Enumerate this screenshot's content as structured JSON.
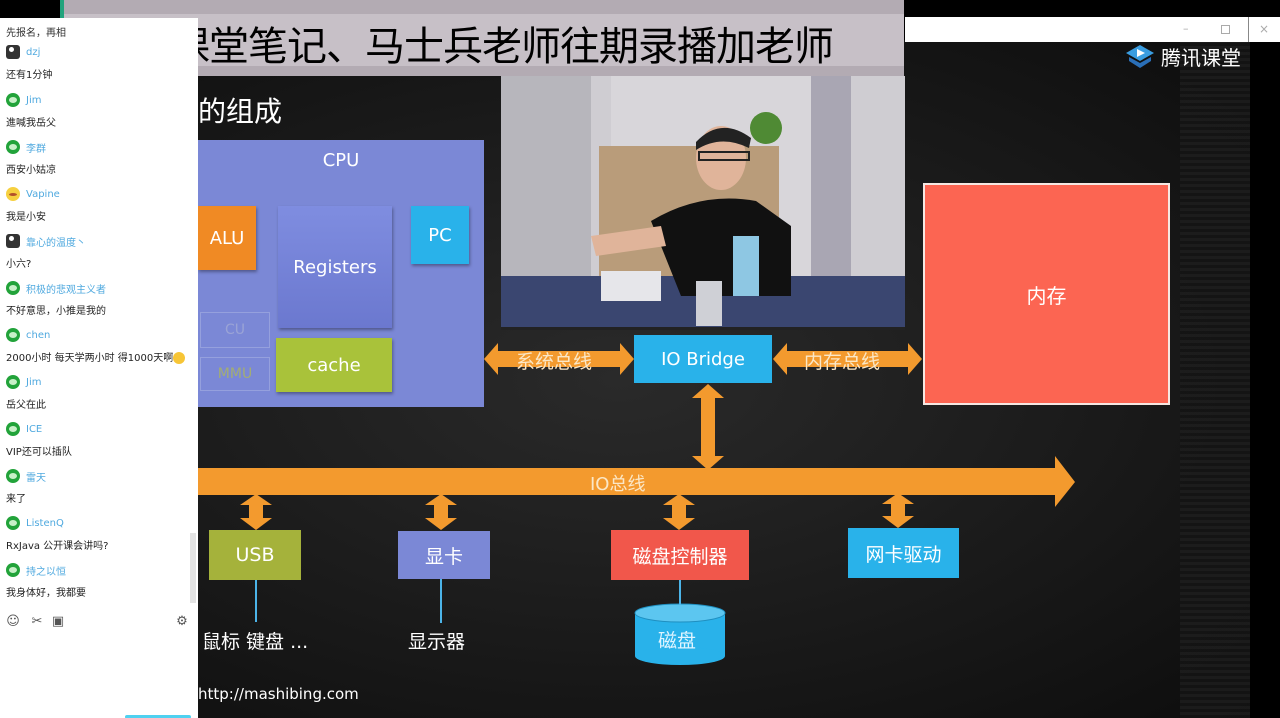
{
  "window": {
    "controls": {
      "minimize": "–",
      "close": "×"
    }
  },
  "banner": {
    "text": "领取课堂笔记、马士兵老师往期录播加老师"
  },
  "branding": {
    "logo_icon": "tencent-classroom-play-icon",
    "name": "腾讯课堂"
  },
  "slide": {
    "title": "的组成",
    "cpu": {
      "label": "CPU",
      "alu": "ALU",
      "registers": "Registers",
      "pc": "PC",
      "cu": "CU",
      "mmu": "MMU",
      "cache": "cache"
    },
    "io_bridge": "IO Bridge",
    "system_bus": "系统总线",
    "memory_bus": "内存总线",
    "memory": "内存",
    "io_bus": "IO总线",
    "devices": [
      {
        "label": "USB",
        "attached": "鼠标 键盘 ..."
      },
      {
        "label": "显卡",
        "attached": "显示器"
      },
      {
        "label": "磁盘控制器",
        "attached": "磁盘"
      },
      {
        "label": "网卡驱动",
        "attached": ""
      }
    ],
    "url": "http://mashibing.com",
    "colors": {
      "cpu": "#7b88d6",
      "alu": "#f08a24",
      "pc": "#29b2ea",
      "cache": "#a9c23a",
      "bus": "#f39a2e",
      "memory": "#fc6552",
      "usb": "#a5b23b",
      "disk_controller": "#f1574b"
    }
  },
  "chat": {
    "notice": "先报名，再相三",
    "messages": [
      {
        "avatar": "user-avatar",
        "name": "dzj",
        "text": "还有1分钟"
      },
      {
        "avatar": "wechat-avatar",
        "name": "Jim",
        "text": "進喊我岳父"
      },
      {
        "avatar": "wechat-avatar",
        "name": "李群",
        "text": "西安小姑凉"
      },
      {
        "avatar": "emoji-avatar",
        "name": "Vapine",
        "text": "我是小安"
      },
      {
        "avatar": "user-avatar",
        "name": "靠心的温度丶",
        "text": "小六?"
      },
      {
        "avatar": "wechat-avatar",
        "name": "积极的悲观主义者",
        "text": "不好意思，小推是我的"
      },
      {
        "avatar": "wechat-avatar",
        "name": "chen",
        "text": "2000小时 每天学两小时 得1000天啊"
      },
      {
        "avatar": "wechat-avatar",
        "name": "Jim",
        "text": "岳父在此"
      },
      {
        "avatar": "wechat-avatar",
        "name": "ICE",
        "text": "VIP还可以插队"
      },
      {
        "avatar": "wechat-avatar",
        "name": "雷天",
        "text": "来了"
      },
      {
        "avatar": "wechat-avatar",
        "name": "ListenQ",
        "text": "RxJava 公开课会讲吗?"
      },
      {
        "avatar": "wechat-avatar",
        "name": "持之以恒",
        "text": "我身体好，我都要"
      }
    ],
    "tools": {
      "emoji": "☺",
      "scissors": "✂",
      "image": "▣",
      "settings": "⚙"
    }
  }
}
